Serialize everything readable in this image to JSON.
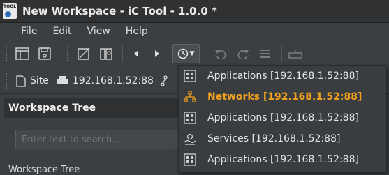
{
  "window": {
    "title": "New Workspace - iC Tool - 1.0.0 *",
    "icon_text": "TOOL"
  },
  "menu": [
    "File",
    "Edit",
    "View",
    "Help"
  ],
  "location": {
    "site_label": "Site",
    "address": "192.168.1.52:88"
  },
  "panel": {
    "title": "Workspace Tree",
    "search_placeholder": "Enter text to search...",
    "tree_root": "Workspace Tree"
  },
  "history_menu": {
    "items": [
      {
        "label": "Applications [192.168.1.52:88]",
        "icon": "applications-icon",
        "active": false
      },
      {
        "label": "Networks [192.168.1.52:88]",
        "icon": "network-icon",
        "active": true
      },
      {
        "label": "Applications [192.168.1.52:88]",
        "icon": "applications-icon",
        "active": false
      },
      {
        "label": "Services [192.168.1.52:88]",
        "icon": "services-icon",
        "active": false
      },
      {
        "label": "Applications [192.168.1.52:88]",
        "icon": "applications-icon",
        "active": false
      }
    ]
  },
  "colors": {
    "accent_active": "#f0a01e",
    "background": "#3c3f41",
    "titlebar": "#2f3133"
  }
}
